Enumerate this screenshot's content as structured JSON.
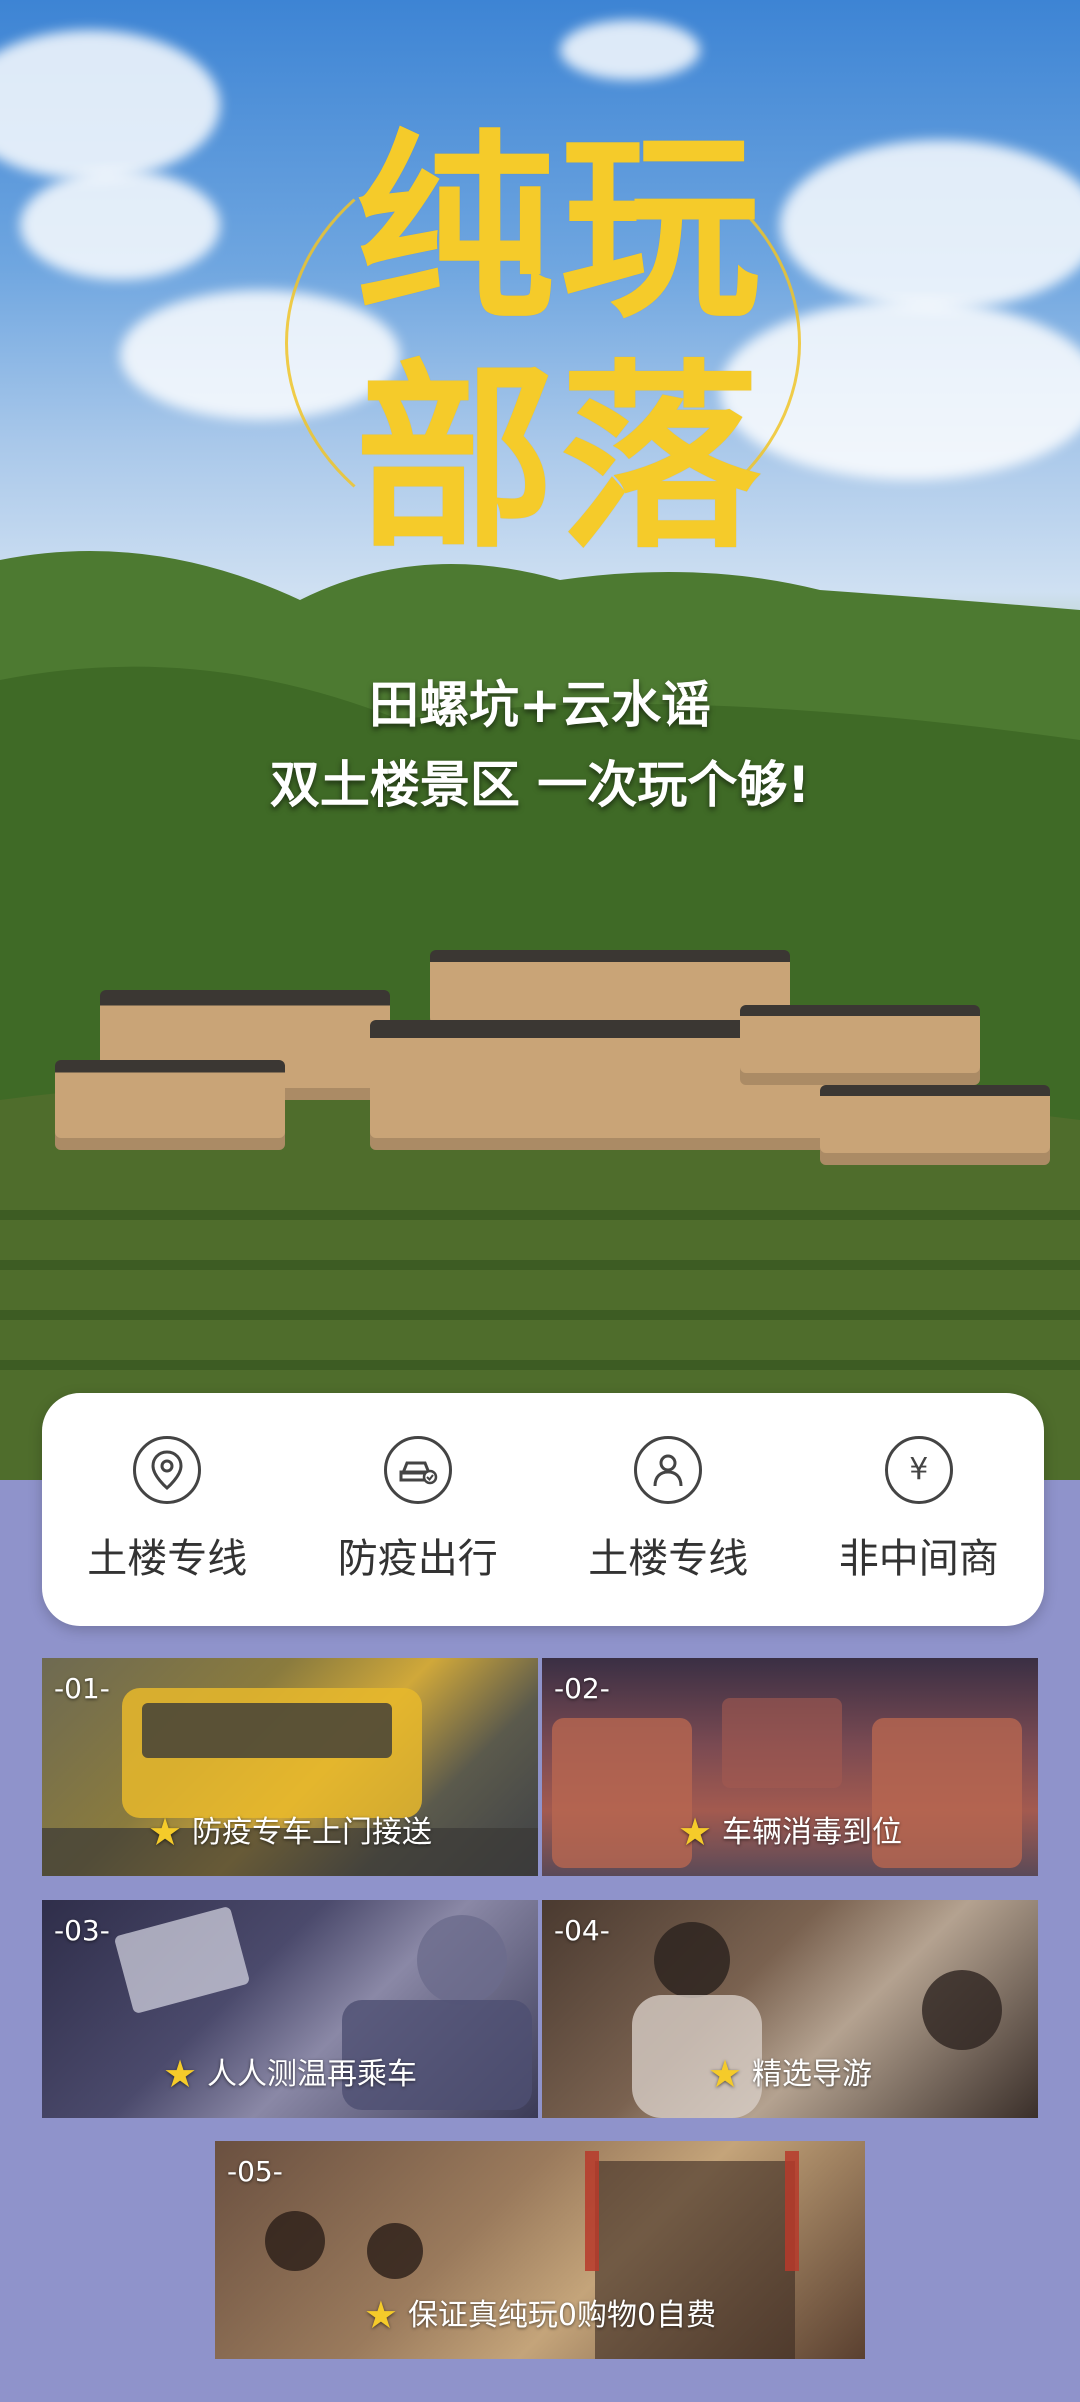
{
  "poster": {
    "title_chars": [
      "纯",
      "玩",
      "部",
      "落"
    ],
    "subtitle_line1": "田螺坑+云水谣",
    "subtitle_line2": "双土楼景区 一次玩个够!"
  },
  "features": [
    {
      "label": "土楼专线",
      "icon": "location-pin-icon"
    },
    {
      "label": "防疫出行",
      "icon": "car-check-icon"
    },
    {
      "label": "土楼专线",
      "icon": "person-icon"
    },
    {
      "label": "非中间商",
      "icon": "yen-icon"
    }
  ],
  "cards": [
    {
      "num": "-01-",
      "caption": "防疫专车上门接送"
    },
    {
      "num": "-02-",
      "caption": "车辆消毒到位"
    },
    {
      "num": "-03-",
      "caption": "人人测温再乘车"
    },
    {
      "num": "-04-",
      "caption": "精选导游"
    },
    {
      "num": "-05-",
      "caption": "保证真纯玩0购物0自费"
    }
  ],
  "colors": {
    "accent": "#f5cb2a",
    "background": "#8f93cb",
    "card_white": "#ffffff"
  }
}
